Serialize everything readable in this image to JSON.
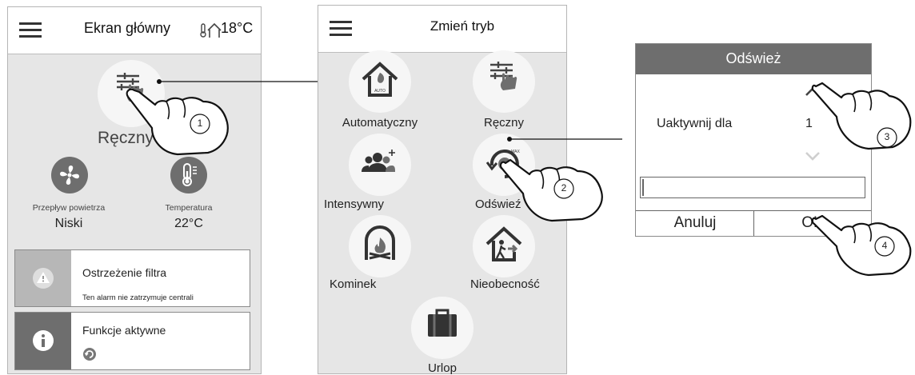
{
  "screen1": {
    "title": "Ekran główny",
    "temperature": "18°C",
    "mode_label": "Ręczny",
    "airflow": {
      "label": "Przepływ powietrza",
      "value": "Niski"
    },
    "temperature_sensor": {
      "label": "Temperatura",
      "value": "22°C"
    },
    "alarm_card": {
      "title": "Ostrzeżenie filtra",
      "text": "Ten alarm nie zatrzymuje centrali"
    },
    "functions_card": {
      "title": "Funkcje aktywne"
    }
  },
  "screen2": {
    "title": "Zmień tryb",
    "modes": [
      {
        "label": "Automatyczny"
      },
      {
        "label": "Ręczny"
      },
      {
        "label": "Intensywny"
      },
      {
        "label": "Odświeź"
      },
      {
        "label": "Kominek"
      },
      {
        "label": "Nieobecność"
      },
      {
        "label": "Urlop"
      }
    ]
  },
  "dialog": {
    "title": "Odśwież",
    "field_label": "Uaktywnij dla",
    "field_value": "1",
    "cancel_label": "Anuluj",
    "ok_label": "OK"
  },
  "callouts": [
    "1",
    "2",
    "3",
    "4"
  ],
  "colors": {
    "panel_bg": "#e6e6e6",
    "header_dark": "#6e6e6e",
    "icon_dark": "#6e6e6e"
  }
}
